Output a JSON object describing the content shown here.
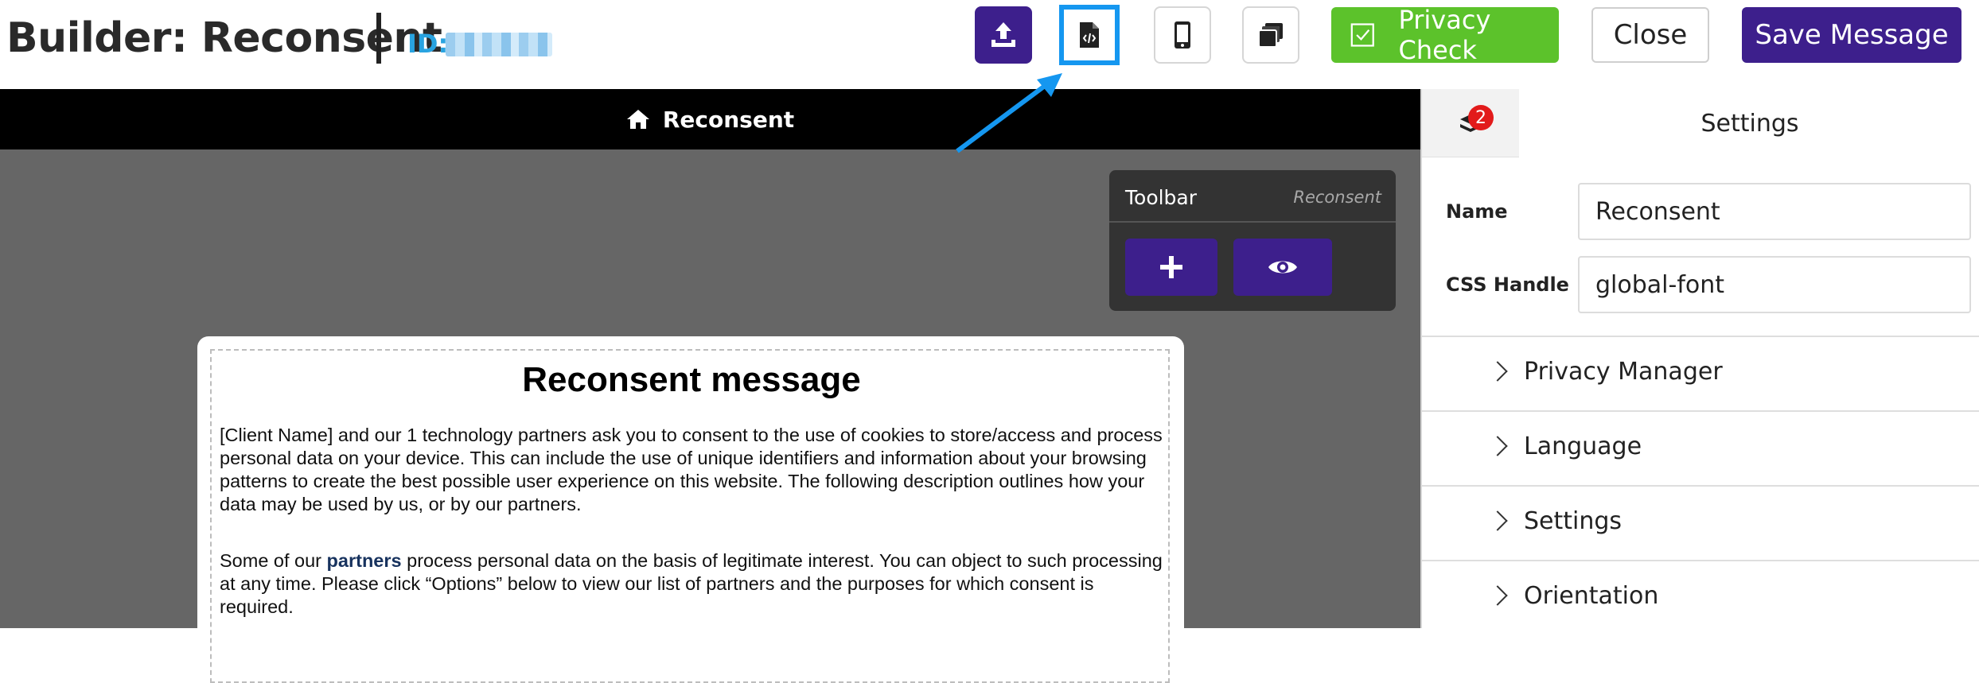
{
  "header": {
    "title": "Builder: Reconsent",
    "id_label": "ID:",
    "buttons": {
      "upload_icon": "upload-icon",
      "code_icon": "code-file-icon",
      "mobile_icon": "mobile-phone-icon",
      "layers_icon": "layers-icon",
      "privacy_check": "Privacy Check",
      "close": "Close",
      "save": "Save Message"
    }
  },
  "canvas": {
    "header_title": "Reconsent",
    "toolbar": {
      "title": "Toolbar",
      "context": "Reconsent"
    },
    "message": {
      "title": "Reconsent message",
      "paragraph1": "[Client Name] and our 1 technology partners ask you to consent to the use of cookies to store/access and process personal data on your device. This can include the use of unique identifiers and information about your browsing patterns to create the best possible user experience on this website. The following description outlines how your data may be used by us, or by our partners.",
      "paragraph2_before": "Some of our ",
      "paragraph2_link": "partners",
      "paragraph2_after": " process personal data on the basis of legitimate interest. You can object to such processing at any time. Please click “Options” below to view our list of partners and the purposes for which consent is required."
    }
  },
  "right_panel": {
    "badge_count": "2",
    "tab_title": "Settings",
    "name_label": "Name",
    "name_value": "Reconsent",
    "css_label": "CSS Handle",
    "css_value": "global-font",
    "sections": [
      "Privacy Manager",
      "Language",
      "Settings",
      "Orientation"
    ]
  },
  "colors": {
    "brand_purple": "#3d1f8c",
    "privacy_green": "#5cc22b",
    "highlight_blue": "#1597f0",
    "id_blue": "#29a3e0",
    "badge_red": "#e21b1b"
  }
}
